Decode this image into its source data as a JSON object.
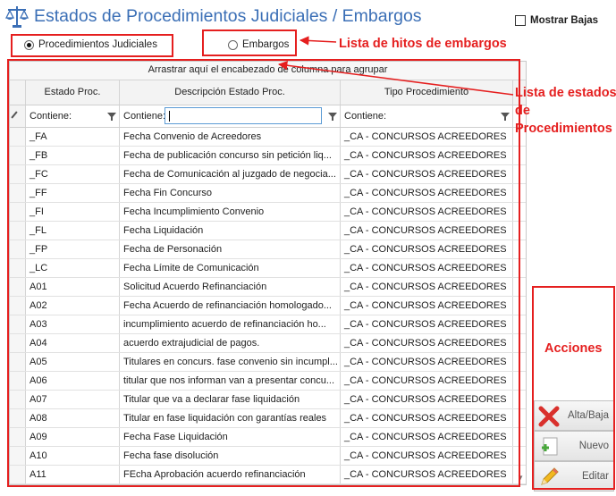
{
  "header": {
    "title": "Estados de Procedimientos Judiciales / Embargos",
    "show_inactive_label": "Mostrar Bajas"
  },
  "options": {
    "procedures_label": "Procedimientos Judiciales",
    "seizures_label": "Embargos",
    "selected": "procedures"
  },
  "annotations": {
    "seizures_note": "Lista de hitos de embargos",
    "states_note_line1": "Lista de estados",
    "states_note_line2": "de",
    "states_note_line3": "Procedimientos",
    "actions_note": "Acciones"
  },
  "grid": {
    "group_hint": "Arrastrar aquí el encabezado de columna para agrupar",
    "columns": [
      "Estado Proc.",
      "Descripción Estado Proc.",
      "Tipo Procedimiento"
    ],
    "filter_text": "Contiene:",
    "rows": [
      [
        "_FA",
        "Fecha Convenio de Acreedores",
        "_CA - CONCURSOS ACREEDORES"
      ],
      [
        "_FB",
        "Fecha de publicación concurso sin petición liq...",
        "_CA - CONCURSOS ACREEDORES"
      ],
      [
        "_FC",
        "Fecha de Comunicación al juzgado de negocia...",
        "_CA - CONCURSOS ACREEDORES"
      ],
      [
        "_FF",
        "Fecha Fin Concurso",
        "_CA - CONCURSOS ACREEDORES"
      ],
      [
        "_FI",
        "Fecha Incumplimiento Convenio",
        "_CA - CONCURSOS ACREEDORES"
      ],
      [
        "_FL",
        "Fecha Liquidación",
        "_CA - CONCURSOS ACREEDORES"
      ],
      [
        "_FP",
        "Fecha de Personación",
        "_CA - CONCURSOS ACREEDORES"
      ],
      [
        "_LC",
        "Fecha Límite de Comunicación",
        "_CA - CONCURSOS ACREEDORES"
      ],
      [
        "A01",
        "Solicitud Acuerdo Refinanciación",
        "_CA - CONCURSOS ACREEDORES"
      ],
      [
        "A02",
        "Fecha Acuerdo de refinanciación homologado...",
        "_CA - CONCURSOS ACREEDORES"
      ],
      [
        "A03",
        "incumplimiento acuerdo de refinanciación ho...",
        "_CA - CONCURSOS ACREEDORES"
      ],
      [
        "A04",
        "acuerdo extrajudicial de pagos.",
        "_CA - CONCURSOS ACREEDORES"
      ],
      [
        "A05",
        "Titulares en concurs. fase convenio sin incumpl...",
        "_CA - CONCURSOS ACREEDORES"
      ],
      [
        "A06",
        "titular que nos informan van a presentar concu...",
        "_CA - CONCURSOS ACREEDORES"
      ],
      [
        "A07",
        "Titular que va a declarar fase liquidación",
        "_CA - CONCURSOS ACREEDORES"
      ],
      [
        "A08",
        "Titular en fase liquidación con garantías reales",
        "_CA - CONCURSOS ACREEDORES"
      ],
      [
        "A09",
        "Fecha Fase Liquidación",
        "_CA - CONCURSOS ACREEDORES"
      ],
      [
        "A10",
        "Fecha fase disolución",
        "_CA - CONCURSOS ACREEDORES"
      ],
      [
        "A11",
        "FEcha Aprobación acuerdo refinanciación",
        "_CA - CONCURSOS ACREEDORES"
      ]
    ]
  },
  "actions": {
    "toggle_label": "Alta/Baja",
    "new_label": "Nuevo",
    "edit_label": "Editar"
  },
  "colors": {
    "title": "#3b6fb6",
    "annotation": "#e51f1f"
  }
}
